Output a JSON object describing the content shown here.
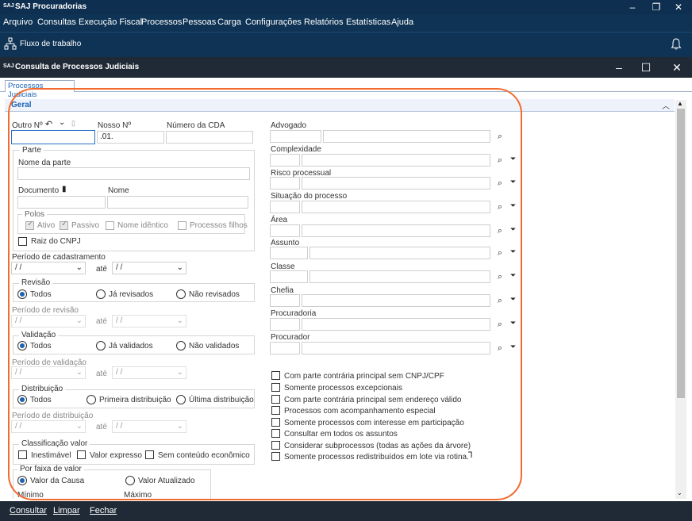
{
  "app": {
    "logo": "SAJ",
    "title": "SAJ Procuradorias"
  },
  "menu": [
    "Arquivo",
    "Consultas",
    "Execução Fiscal",
    "Processos",
    "Pessoas",
    "Carga",
    "Configurações",
    "Relatórios",
    "Estatísticas",
    "Ajuda"
  ],
  "toolbar": {
    "workflow_label": "Fluxo de trabalho"
  },
  "child": {
    "logo": "SAJ",
    "title": "Consulta de Processos Judiciais"
  },
  "tab": "Processos Judiciais",
  "section": "Geral",
  "left": {
    "outro_no": "Outro Nº",
    "nosso_no": "Nosso Nº",
    "nosso_no_value": ".01.",
    "numero_cda": "Número da CDA",
    "parte_group": "Parte",
    "nome_da_parte": "Nome da parte",
    "documento": "Documento",
    "nome": "Nome",
    "polos_group": "Polos",
    "ativo": "Ativo",
    "passivo": "Passivo",
    "nome_identico": "Nome idêntico",
    "processos_filhos": "Processos filhos",
    "raiz_cnpj": "Raiz do CNPJ",
    "periodo_cadastramento": "Período de cadastramento",
    "date_placeholder": "/ /",
    "ate": "até",
    "revisao_group": "Revisão",
    "revisao_options": [
      "Todos",
      "Já revisados",
      "Não revisados"
    ],
    "periodo_revisao": "Período de revisão",
    "validacao_group": "Validação",
    "validacao_options": [
      "Todos",
      "Já validados",
      "Não validados"
    ],
    "periodo_validacao": "Período de validação",
    "distribuicao_group": "Distribuição",
    "distribuicao_options": [
      "Todos",
      "Primeira distribuição",
      "Última distribuição"
    ],
    "periodo_distribuicao": "Período de distribuição",
    "classificacao_group": "Classificação valor",
    "classificacao_options": [
      "Inestimável",
      "Valor expresso",
      "Sem conteúdo econômico"
    ],
    "faixa_group": "Por faixa de valor",
    "faixa_options": [
      "Valor da Causa",
      "Valor Atualizado"
    ],
    "minimo": "Mínimo",
    "maximo": "Máximo"
  },
  "right": {
    "fields": [
      "Advogado",
      "Complexidade",
      "Risco processual",
      "Situação do processo",
      "Área",
      "Assunto",
      "Classe",
      "Chefia",
      "Procuradoria",
      "Procurador"
    ],
    "checkboxes": [
      "Com parte contrária principal sem CNPJ/CPF",
      "Somente processos excepcionais",
      "Com parte contrária principal sem endereço válido",
      "Processos com acompanhamento especial",
      "Somente processos com interesse em participação",
      "Consultar em todos os assuntos",
      "Considerar subprocessos (todas as ações da árvore)",
      "Somente processos redistribuídos em lote via rotina."
    ]
  },
  "footer": [
    "Consultar",
    "Limpar",
    "Fechar"
  ],
  "colors": {
    "title_bar": "#0e2f4f",
    "menu_bar": "#0e3354",
    "child_title": "#1f2a36",
    "accent": "#1a63b5",
    "highlight": "#f26a2e"
  }
}
